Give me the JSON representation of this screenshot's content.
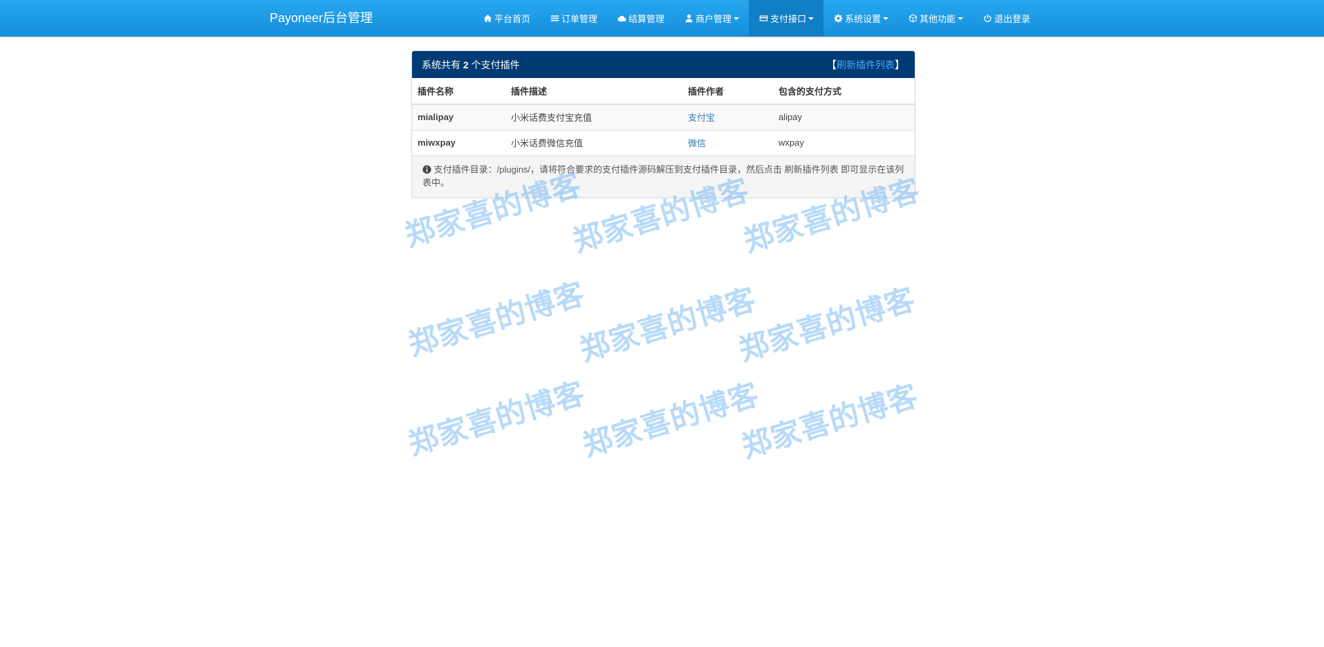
{
  "navbar": {
    "brand": "Payoneer后台管理",
    "items": [
      {
        "label": "平台首页",
        "icon": "home-icon",
        "dropdown": false,
        "active": false
      },
      {
        "label": "订单管理",
        "icon": "list-icon",
        "dropdown": false,
        "active": false
      },
      {
        "label": "结算管理",
        "icon": "cloud-icon",
        "dropdown": false,
        "active": false
      },
      {
        "label": "商户管理",
        "icon": "user-icon",
        "dropdown": true,
        "active": false
      },
      {
        "label": "支付接口",
        "icon": "credit-card-icon",
        "dropdown": true,
        "active": true
      },
      {
        "label": "系统设置",
        "icon": "gear-icon",
        "dropdown": true,
        "active": false
      },
      {
        "label": "其他功能",
        "icon": "cube-icon",
        "dropdown": true,
        "active": false
      },
      {
        "label": "退出登录",
        "icon": "power-icon",
        "dropdown": false,
        "active": false
      }
    ]
  },
  "panel": {
    "title_prefix": "系统共有",
    "count": "2",
    "title_suffix": "个支付插件",
    "refresh_open": "【",
    "refresh_label": "刷新插件列表",
    "refresh_close": "】",
    "columns": [
      "插件名称",
      "插件描述",
      "插件作者",
      "包含的支付方式"
    ],
    "rows": [
      {
        "name": "mialipay",
        "description": "小米话费支付宝充值",
        "author": "支付宝",
        "methods": "alipay"
      },
      {
        "name": "miwxpay",
        "description": "小米话费微信充值",
        "author": "微信",
        "methods": "wxpay"
      }
    ],
    "footer_note": "支付插件目录：/plugins/，请将符合要求的支付插件源码解压到支付插件目录，然后点击 刷新插件列表 即可显示在该列表中。"
  },
  "watermark": {
    "text": "郑家喜的博客"
  },
  "colors": {
    "navbar": "#1d9ae6",
    "active_nav": "#117fc6",
    "panel_heading": "#003b73",
    "link": "#337ab7",
    "watermark": "#56a6f0"
  }
}
